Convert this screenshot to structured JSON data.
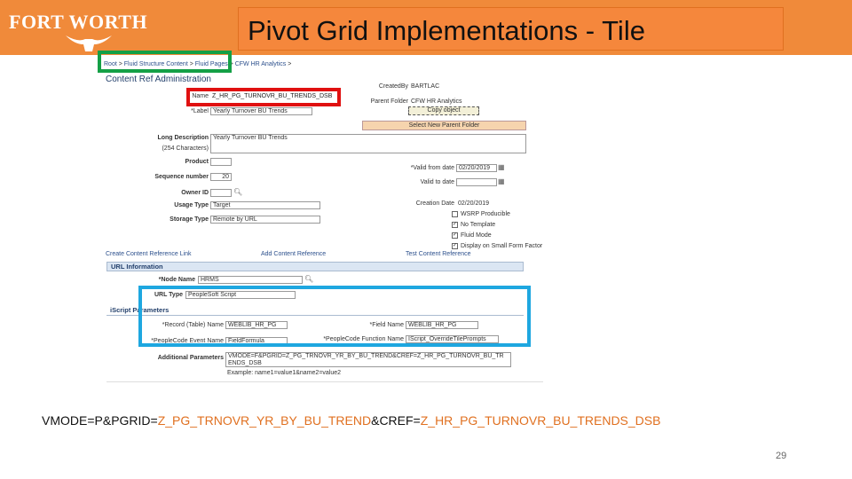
{
  "header": {
    "logo": "FORT WORTH",
    "title": "Pivot Grid Implementations - Tile"
  },
  "breadcrumb": {
    "root": "Root",
    "fluid_content": "Fluid Structure Content",
    "fluid_pages": "Fluid Pages",
    "hr_analytics": "CFW HR Analytics"
  },
  "panel": {
    "title": "Content Ref Administration",
    "name_label": "Name",
    "name_value": "Z_HR_PG_TURNOVR_BU_TRENDS_DSB",
    "label_label": "*Label",
    "label_value": "Yearly Turnover BU Trends",
    "created_by_label": "CreatedBy",
    "created_by_value": "BARTLAC",
    "parent_folder_label": "Parent Folder",
    "parent_folder_value": "CFW HR Analytics",
    "copy_object": "Copy object",
    "select_parent": "Select New Parent Folder",
    "long_desc_label": "Long Description",
    "long_desc_chars": "(254 Characters)",
    "long_desc_value": "Yearly Turnover BU Trends",
    "product_label": "Product",
    "sequence_label": "Sequence number",
    "sequence_value": "20",
    "owner_label": "Owner ID",
    "usage_label": "Usage Type",
    "usage_value": "Target",
    "storage_label": "Storage Type",
    "storage_value": "Remote by URL",
    "valid_from_label": "*Valid from date",
    "valid_from_value": "02/20/2019",
    "valid_to_label": "Valid to date",
    "creation_label": "Creation Date",
    "creation_value": "02/20/2019",
    "wsrp": "WSRP Producible",
    "no_template": "No Template",
    "fluid_mode": "Fluid Mode",
    "small_form": "Display on Small Form Factor",
    "create_link": "Create Content Reference Link",
    "add_ref": "Add Content Reference",
    "test_ref": "Test Content Reference",
    "url_info": "URL Information",
    "node_label": "*Node Name",
    "node_value": "HRMS",
    "url_type_label": "URL Type",
    "url_type_value": "PeopleSoft Script",
    "iscript_hdr": "iScript Parameters",
    "record_label": "*Record (Table) Name",
    "record_value": "WEBLIB_HR_PG",
    "field_label": "*Field Name",
    "field_value": "WEBLIB_HR_PG",
    "event_label": "*PeopleCode Event Name",
    "event_value": "FieldFormula",
    "function_label": "*PeopleCode Function Name",
    "function_value": "IScript_OverrideTilePrompts",
    "addl_label": "Additional Parameters",
    "addl_line1": "VMODE=F&PGRID=Z_PG_TRNOVR_YR_BY_BU_TREND&CREF=Z_HR_PG_TURNOVR_BU_TR",
    "addl_line2": "ENDS_DSB",
    "example": "Example: name1=value1&name2=value2"
  },
  "formula": {
    "p1": "VMODE=P&PGRID=",
    "p2": "Z_PG_TRNOVR_YR_BY_BU_TREND",
    "p3": "&CREF=",
    "p4": "Z_HR_PG_TURNOVR_BU_TRENDS_DSB"
  },
  "page_number": "29"
}
